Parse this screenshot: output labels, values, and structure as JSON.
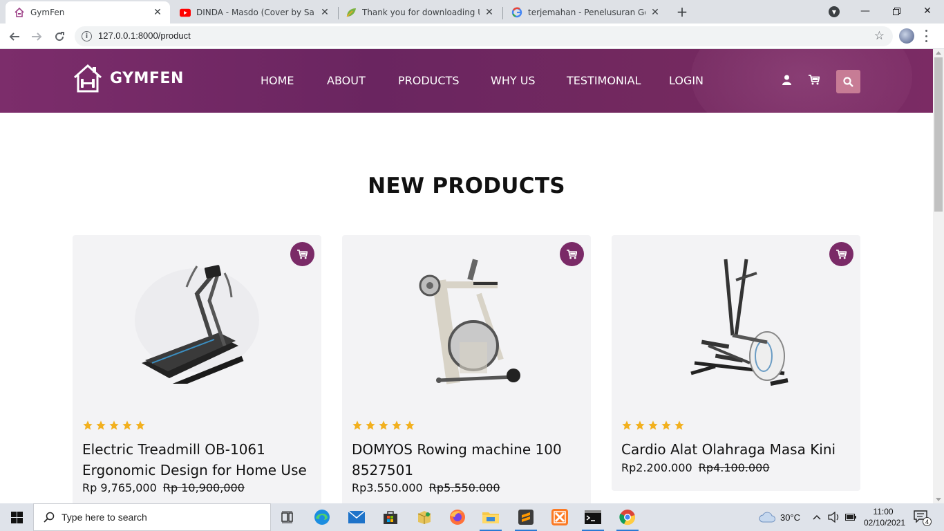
{
  "browser": {
    "tabs": [
      {
        "title": "GymFen",
        "active": true
      },
      {
        "title": "DINDA - Masdo (Cover by Saidah",
        "active": false
      },
      {
        "title": "Thank you for downloading Unlo",
        "active": false
      },
      {
        "title": "terjemahan - Penelusuran Google",
        "active": false
      }
    ],
    "url": "127.0.0.1:8000/product"
  },
  "site": {
    "brand": "GYMFEN",
    "nav": [
      "HOME",
      "ABOUT",
      "PRODUCTS",
      "WHY US",
      "TESTIMONIAL",
      "LOGIN"
    ],
    "section_title": "NEW PRODUCTS",
    "accent_color": "#7a2a67",
    "search_button_color": "#c77c95",
    "star_color": "#f2b01e",
    "products": [
      {
        "name": "Electric Treadmill OB-1061 Ergonomic Design for Home Use",
        "price": "Rp 9,765,000",
        "old_price": "Rp 10,900,000",
        "rating": 5
      },
      {
        "name": "DOMYOS Rowing machine 100 8527501",
        "price": "Rp3.550.000",
        "old_price": "Rp5.550.000",
        "rating": 5
      },
      {
        "name": "Cardio Alat Olahraga Masa Kini",
        "price": "Rp2.200.000",
        "old_price": "Rp4.100.000",
        "rating": 5
      }
    ]
  },
  "taskbar": {
    "search_placeholder": "Type here to search",
    "weather": "30°C",
    "time": "11:00",
    "date": "02/10/2021",
    "notification_count": "4"
  }
}
